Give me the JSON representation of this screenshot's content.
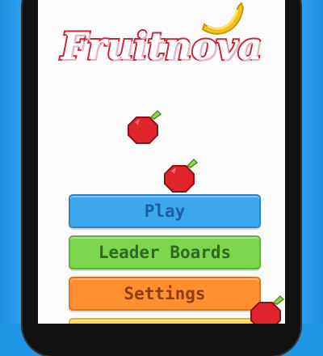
{
  "game": {
    "title": "Fruitnova"
  },
  "menu": {
    "play_label": "Play",
    "leaderboards_label": "Leader Boards",
    "settings_label": "Settings"
  },
  "sprites": {
    "falling": [
      "banana",
      "apple",
      "apple",
      "apple"
    ]
  },
  "colors": {
    "background": "#2aa4f0",
    "title_outline": "#c8283a",
    "play": "#3ea8ec",
    "leaderboards": "#7ed64f",
    "settings": "#ff8f2f",
    "fourth_button": "#ffd84a"
  }
}
